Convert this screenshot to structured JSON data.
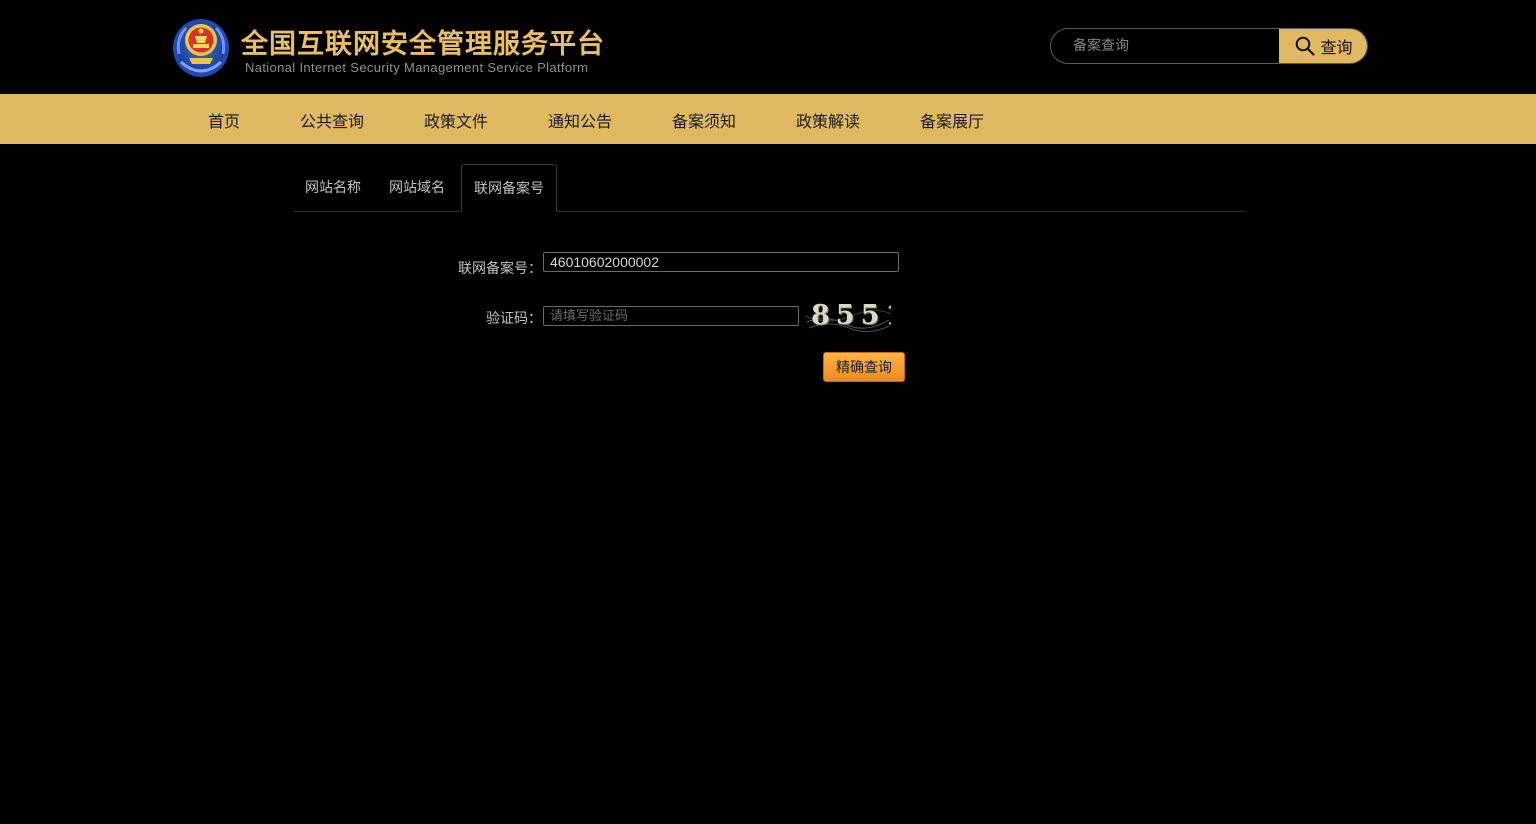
{
  "header": {
    "title_cn": "全国互联网安全管理服务平台",
    "title_en": "National Internet Security Management Service Platform",
    "search": {
      "placeholder": "备案查询",
      "button_label": "查询"
    }
  },
  "nav": {
    "items": [
      "首页",
      "公共查询",
      "政策文件",
      "通知公告",
      "备案须知",
      "政策解读",
      "备案展厅"
    ]
  },
  "tabs": {
    "items": [
      "网站名称",
      "网站域名",
      "联网备案号"
    ],
    "active_index": 2
  },
  "form": {
    "record_label": "联网备案号：",
    "record_value": "46010602000002",
    "captcha_label": "验证码：",
    "captcha_placeholder": "请填写验证码",
    "captcha_text": "8551",
    "submit_label": "精确查询"
  },
  "colors": {
    "accent": "#dfb862",
    "title": "#e8bf68",
    "button": "#f7a035",
    "background": "#000000"
  }
}
